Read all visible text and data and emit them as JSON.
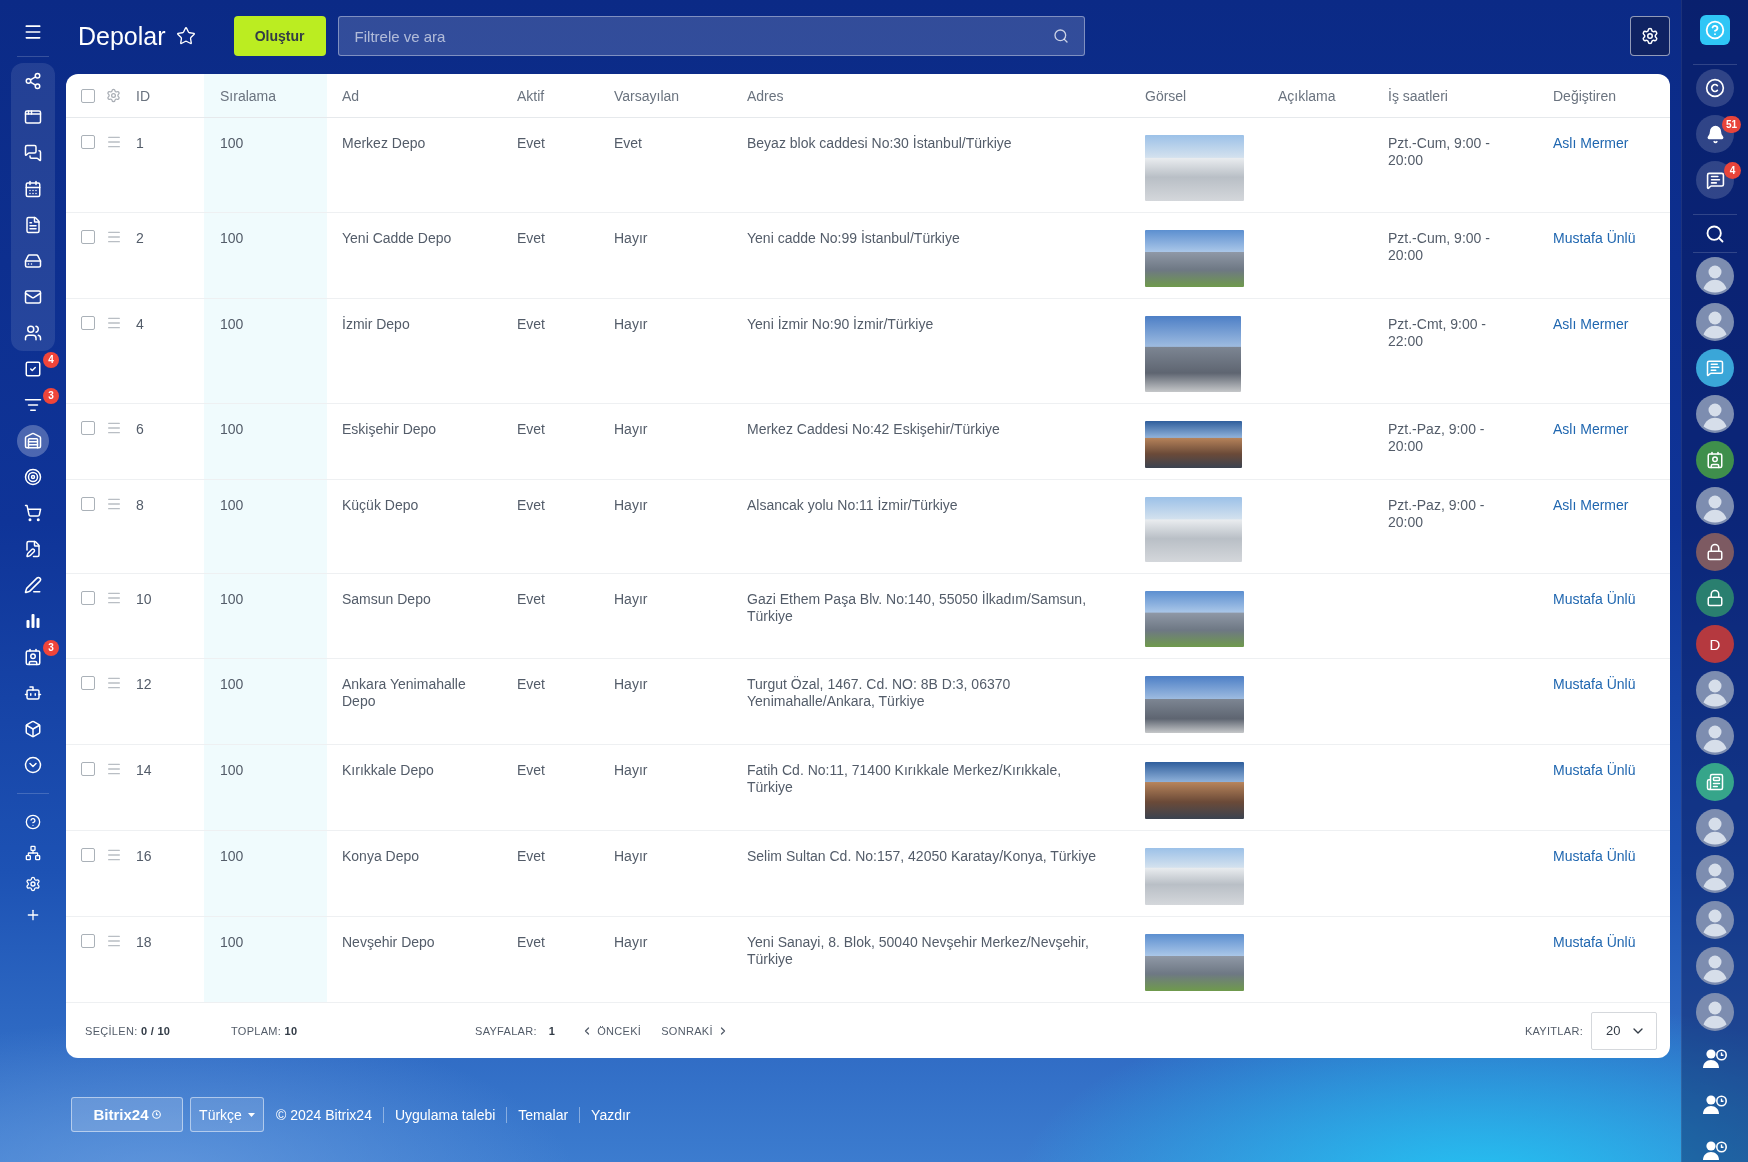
{
  "left_sidebar": {
    "pinned": [
      {
        "selected": false
      },
      {
        "selected": false
      },
      {
        "selected": false
      },
      {
        "selected": false
      },
      {
        "selected": false
      },
      {
        "selected": false
      },
      {
        "selected": false
      },
      {
        "selected": false
      }
    ],
    "items": [
      {
        "selected": false,
        "badge": "4"
      },
      {
        "selected": false,
        "badge": "3"
      },
      {
        "selected": true
      },
      {
        "selected": false
      },
      {
        "selected": false
      },
      {
        "selected": false
      },
      {
        "selected": false
      },
      {
        "selected": false
      },
      {
        "selected": false,
        "badge": "3"
      },
      {
        "selected": false
      },
      {
        "selected": false
      },
      {
        "selected": false
      }
    ]
  },
  "header": {
    "title": "Depolar",
    "favorite": false,
    "create_button": "Oluştur",
    "search_placeholder": "Filtrele ve ara"
  },
  "table": {
    "select_all": false,
    "columns": [
      {
        "label": "ID",
        "sorted": false
      },
      {
        "label": "Sıralama",
        "sorted": true
      },
      {
        "label": "Ad",
        "sorted": false
      },
      {
        "label": "Aktif",
        "sorted": false
      },
      {
        "label": "Varsayılan",
        "sorted": false
      },
      {
        "label": "Adres",
        "sorted": false
      },
      {
        "label": "Görsel",
        "sorted": false
      },
      {
        "label": "Açıklama",
        "sorted": false
      },
      {
        "label": "İş saatleri",
        "sorted": false
      },
      {
        "label": "Değiştiren",
        "sorted": false
      }
    ],
    "rows": [
      {
        "checked": false,
        "id": "1",
        "sort": "100",
        "name": "Merkez Depo",
        "active": "Evet",
        "default": "Evet",
        "address": "Beyaz blok caddesi No:30 İstanbul/Türkiye",
        "hours": "Pzt.-Cum, 9:00 - 20:00",
        "modified_by": "Aslı Mermer"
      },
      {
        "checked": false,
        "id": "2",
        "sort": "100",
        "name": "Yeni Cadde Depo",
        "active": "Evet",
        "default": "Hayır",
        "address": "Yeni cadde No:99 İstanbul/Türkiye",
        "hours": "Pzt.-Cum, 9:00 - 20:00",
        "modified_by": "Mustafa Ünlü"
      },
      {
        "checked": false,
        "id": "4",
        "sort": "100",
        "name": "İzmir Depo",
        "active": "Evet",
        "default": "Hayır",
        "address": "Yeni İzmir No:90 İzmir/Türkiye",
        "hours": "Pzt.-Cmt, 9:00 - 22:00",
        "modified_by": "Aslı Mermer"
      },
      {
        "checked": false,
        "id": "6",
        "sort": "100",
        "name": "Eskişehir Depo",
        "active": "Evet",
        "default": "Hayır",
        "address": "Merkez Caddesi No:42 Eskişehir/Türkiye",
        "hours": "Pzt.-Paz, 9:00 - 20:00",
        "modified_by": "Aslı Mermer"
      },
      {
        "checked": false,
        "id": "8",
        "sort": "100",
        "name": "Küçük Depo",
        "active": "Evet",
        "default": "Hayır",
        "address": "Alsancak yolu No:11 İzmir/Türkiye",
        "hours": "Pzt.-Paz, 9:00 - 20:00",
        "modified_by": "Aslı Mermer"
      },
      {
        "checked": false,
        "id": "10",
        "sort": "100",
        "name": "Samsun Depo",
        "active": "Evet",
        "default": "Hayır",
        "address": "Gazi Ethem Paşa Blv. No:140, 55050 İlkadım/Samsun, Türkiye",
        "modified_by": "Mustafa Ünlü"
      },
      {
        "checked": false,
        "id": "12",
        "sort": "100",
        "name": "Ankara Yenimahalle Depo",
        "active": "Evet",
        "default": "Hayır",
        "address": "Turgut Özal, 1467. Cd. NO: 8B D:3, 06370 Yenimahalle/Ankara, Türkiye",
        "modified_by": "Mustafa Ünlü"
      },
      {
        "checked": false,
        "id": "14",
        "sort": "100",
        "name": "Kırıkkale Depo",
        "active": "Evet",
        "default": "Hayır",
        "address": "Fatih Cd. No:11, 71400 Kırıkkale Merkez/Kırıkkale, Türkiye",
        "modified_by": "Mustafa Ünlü"
      },
      {
        "checked": false,
        "id": "16",
        "sort": "100",
        "name": "Konya Depo",
        "active": "Evet",
        "default": "Hayır",
        "address": "Selim Sultan Cd. No:157, 42050 Karatay/Konya, Türkiye",
        "modified_by": "Mustafa Ünlü"
      },
      {
        "checked": false,
        "id": "18",
        "sort": "100",
        "name": "Nevşehir Depo",
        "active": "Evet",
        "default": "Hayır",
        "address": "Yeni Sanayi, 8. Blok, 50040 Nevşehir Merkez/Nevşehir, Türkiye",
        "modified_by": "Mustafa Ünlü"
      }
    ]
  },
  "pagination": {
    "selected": "SEÇİLEN: **0 / 10**",
    "total": "TOPLAM: **10**",
    "pages_label": "SAYFALAR:",
    "current_page": "1",
    "previous": "ÖNCEKİ",
    "next": "SONRAKİ",
    "page_size_label": "KAYITLAR:",
    "page_size": "20"
  },
  "footer": {
    "logo": "Bitrix24",
    "language": "Türkçe",
    "copyright": "© 2024 Bitrix24",
    "links": [
      "Uygulama talebi",
      "Temalar",
      "Yazdır"
    ]
  },
  "right_sidebar": {
    "bell_badge": "51",
    "chats_badge": "4",
    "contacts": [
      {
        "kind": "photo"
      },
      {
        "kind": "photo"
      },
      {
        "kind": "chat",
        "color": "#3aa6d8"
      },
      {
        "kind": "photo"
      },
      {
        "kind": "card",
        "color": "#3f8f4c"
      },
      {
        "kind": "photo"
      },
      {
        "kind": "lock",
        "color": "#7d5a62"
      },
      {
        "kind": "lock",
        "color": "#2a7f6f"
      },
      {
        "kind": "letter",
        "label": "D",
        "color": "#b5393f"
      },
      {
        "kind": "photo"
      },
      {
        "kind": "photo"
      },
      {
        "kind": "news",
        "color": "#36a58a"
      },
      {
        "kind": "photo"
      },
      {
        "kind": "photo"
      },
      {
        "kind": "photo"
      },
      {
        "kind": "photo"
      },
      {
        "kind": "photo"
      }
    ]
  }
}
